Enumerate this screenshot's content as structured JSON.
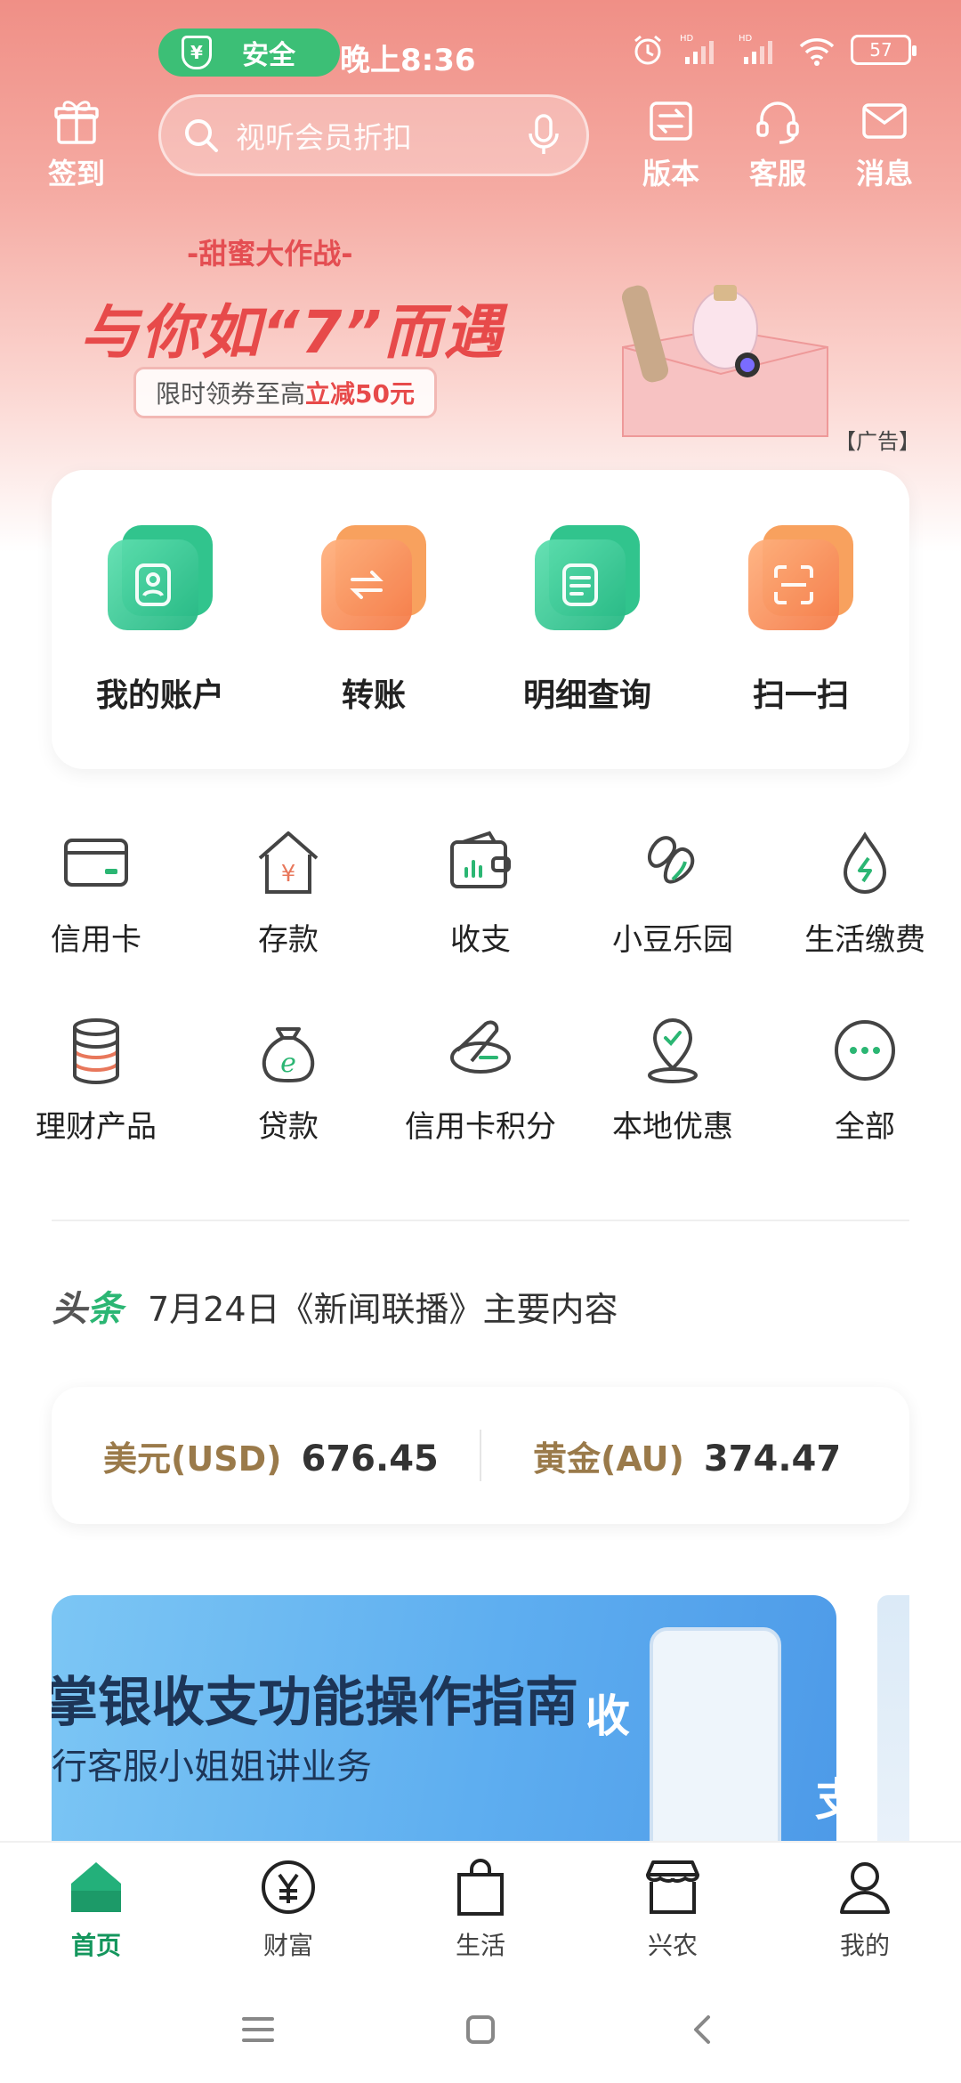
{
  "status_bar": {
    "safe_label": "安全",
    "time": "晚上8:36",
    "battery": "57"
  },
  "header": {
    "signin_label": "签到",
    "search_placeholder": "视听会员折扣",
    "version_label": "版本",
    "service_label": "客服",
    "message_label": "消息"
  },
  "banner": {
    "tagline": "-甜蜜大作战-",
    "headline": "与你如“7”而遇",
    "promo_prefix": "限时领券至高",
    "promo_highlight": "立减50元",
    "ad_label": "【广告】"
  },
  "quick_actions": [
    {
      "label": "我的账户",
      "icon": "account-icon"
    },
    {
      "label": "转账",
      "icon": "transfer-icon"
    },
    {
      "label": "明细查询",
      "icon": "details-icon"
    },
    {
      "label": "扫一扫",
      "icon": "scan-icon"
    }
  ],
  "services": [
    {
      "label": "信用卡",
      "icon": "credit-card-icon"
    },
    {
      "label": "存款",
      "icon": "deposit-icon"
    },
    {
      "label": "收支",
      "icon": "wallet-icon"
    },
    {
      "label": "小豆乐园",
      "icon": "bean-icon"
    },
    {
      "label": "生活缴费",
      "icon": "utility-drop-icon"
    },
    {
      "label": "理财产品",
      "icon": "coins-icon"
    },
    {
      "label": "贷款",
      "icon": "loan-bag-icon"
    },
    {
      "label": "信用卡积分",
      "icon": "points-icon"
    },
    {
      "label": "本地优惠",
      "icon": "location-icon"
    },
    {
      "label": "全部",
      "icon": "more-icon"
    }
  ],
  "news": {
    "badge_a": "头",
    "badge_b": "条",
    "headline": "7月24日《新闻联播》主要内容"
  },
  "rates": [
    {
      "name": "美元(USD)",
      "value": "676.45"
    },
    {
      "name": "黄金(AU)",
      "value": "374.47"
    }
  ],
  "promo_banner": {
    "title": "掌银收支功能操作指南",
    "subtitle": "行客服小姐姐讲业务",
    "word_in": "收",
    "word_out": "支"
  },
  "tabbar": [
    {
      "label": "首页",
      "icon": "home-icon",
      "active": true
    },
    {
      "label": "财富",
      "icon": "wealth-icon",
      "active": false
    },
    {
      "label": "生活",
      "icon": "shopping-bag-icon",
      "active": false
    },
    {
      "label": "兴农",
      "icon": "shop-icon",
      "active": false
    },
    {
      "label": "我的",
      "icon": "profile-icon",
      "active": false
    }
  ],
  "colors": {
    "primary_green": "#14965d",
    "accent_orange": "#f57c4a",
    "banner_red": "#e74a4a",
    "gold_text": "#9a7a4a"
  }
}
